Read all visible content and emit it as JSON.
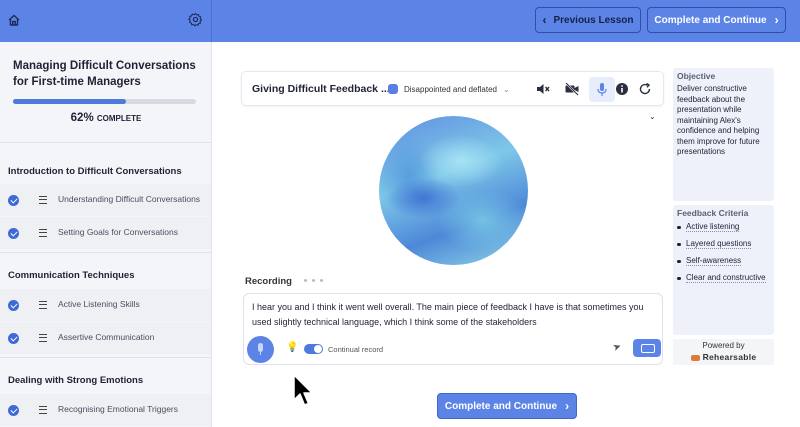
{
  "topbar": {
    "prev_label": "Previous Lesson",
    "next_label": "Complete and Continue"
  },
  "sidebar": {
    "course_title": "Managing Difficult Conversations for First-time Managers",
    "progress_percent": 62,
    "progress_value": "62%",
    "progress_suffix": "COMPLETE",
    "sections": [
      {
        "title": "Introduction to Difficult Conversations",
        "lessons": [
          {
            "label": "Understanding Difficult Conversations",
            "done": true
          },
          {
            "label": "Setting Goals for Conversations",
            "done": true
          }
        ]
      },
      {
        "title": "Communication Techniques",
        "lessons": [
          {
            "label": "Active Listening Skills",
            "done": true
          },
          {
            "label": "Assertive Communication",
            "done": true
          }
        ]
      },
      {
        "title": "Dealing with Strong Emotions",
        "lessons": [
          {
            "label": "Recognising Emotional Triggers",
            "done": true
          }
        ]
      }
    ]
  },
  "conversation": {
    "title": "Giving Difficult Feedback ...",
    "persona": "Disappointed and deflated",
    "recording_label": "Recording",
    "transcript": "I hear you and I think it went well overall. The main piece of feedback I have is that sometimes you used slightly technical language, which I think some of the stakeholders",
    "continual_record_label": "Continual record",
    "continual_record_on": true
  },
  "objective": {
    "heading": "Objective",
    "text": "Deliver constructive feedback about the presentation while maintaining Alex's confidence and helping them improve for future presentations"
  },
  "criteria": {
    "heading": "Feedback Criteria",
    "items": [
      "Active listening",
      "Layered questions",
      "Self-awareness",
      "Clear and constructive"
    ]
  },
  "powered": {
    "label": "Powered by",
    "brand": "Rehearsable"
  },
  "bottom": {
    "complete_label": "Complete and Continue"
  },
  "colors": {
    "accent": "#5b84e6",
    "check": "#3d6ad6",
    "panel": "#eef0fa"
  }
}
